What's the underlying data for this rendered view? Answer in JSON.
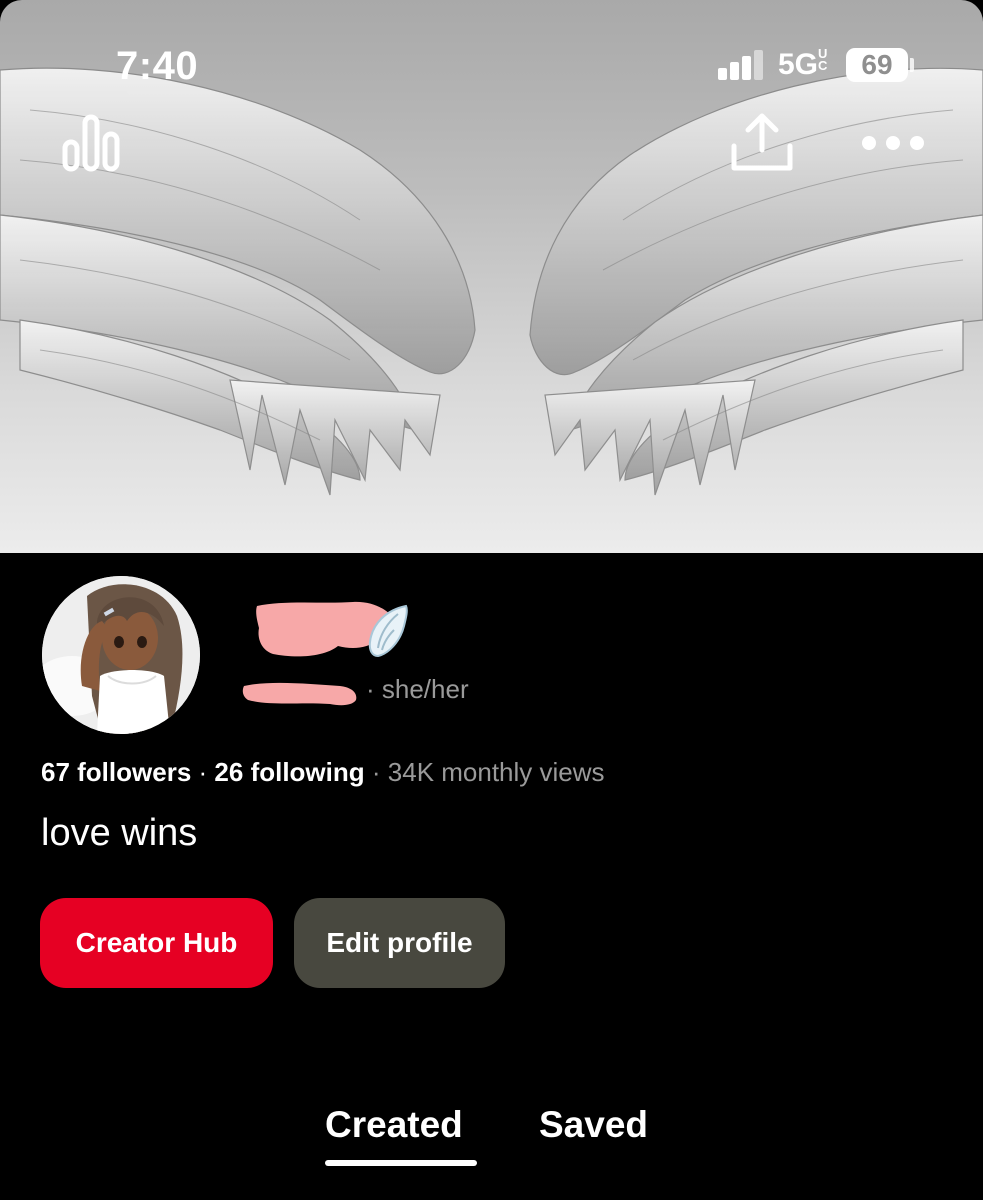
{
  "status_bar": {
    "time": "7:40",
    "network": "5G",
    "network_suffix": "UC",
    "battery": "69"
  },
  "header": {
    "stats_icon": "bar-chart-icon",
    "share_icon": "share-icon",
    "more_icon": "more-dots-icon"
  },
  "profile": {
    "name_emoji": "wing-icon",
    "pronouns": "· she/her",
    "followers": "67 followers",
    "following": "26 following",
    "separator": "·",
    "monthly_views": "· 34K monthly views",
    "bio": "love wins"
  },
  "actions": {
    "creator_hub_label": "Creator Hub",
    "edit_profile_label": "Edit profile"
  },
  "tabs": [
    {
      "label": "Created",
      "selected": true
    },
    {
      "label": "Saved",
      "selected": false
    }
  ],
  "colors": {
    "accent_red": "#e60023",
    "button_gray": "#48483f",
    "redaction_pink": "#f7a8a8",
    "muted_text": "#9a9a9a"
  }
}
